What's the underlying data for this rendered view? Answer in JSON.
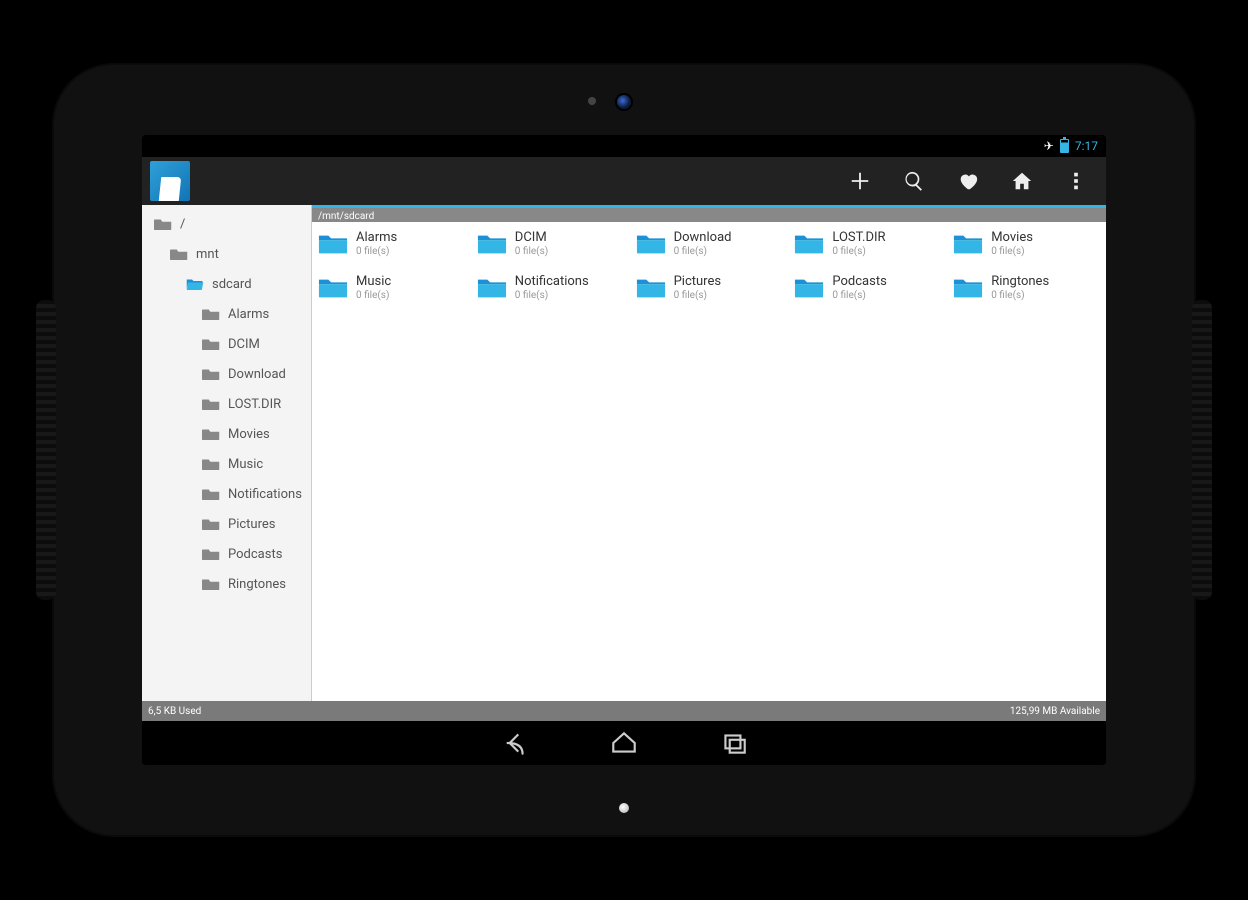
{
  "status": {
    "time": "7:17"
  },
  "header": {
    "path": "/mnt/sdcard"
  },
  "sidebar": {
    "root_label": "/",
    "mnt_label": "mnt",
    "sdcard_label": "sdcard",
    "children": [
      {
        "label": "Alarms"
      },
      {
        "label": "DCIM"
      },
      {
        "label": "Download"
      },
      {
        "label": "LOST.DIR"
      },
      {
        "label": "Movies"
      },
      {
        "label": "Music"
      },
      {
        "label": "Notifications"
      },
      {
        "label": "Pictures"
      },
      {
        "label": "Podcasts"
      },
      {
        "label": "Ringtones"
      }
    ]
  },
  "items": [
    {
      "name": "Alarms",
      "sub": "0 file(s)"
    },
    {
      "name": "DCIM",
      "sub": "0 file(s)"
    },
    {
      "name": "Download",
      "sub": "0 file(s)"
    },
    {
      "name": "LOST.DIR",
      "sub": "0 file(s)"
    },
    {
      "name": "Movies",
      "sub": "0 file(s)"
    },
    {
      "name": "Music",
      "sub": "0 file(s)"
    },
    {
      "name": "Notifications",
      "sub": "0 file(s)"
    },
    {
      "name": "Pictures",
      "sub": "0 file(s)"
    },
    {
      "name": "Podcasts",
      "sub": "0 file(s)"
    },
    {
      "name": "Ringtones",
      "sub": "0 file(s)"
    }
  ],
  "statusline": {
    "used": "6,5 KB Used",
    "available": "125,99 MB Available"
  }
}
